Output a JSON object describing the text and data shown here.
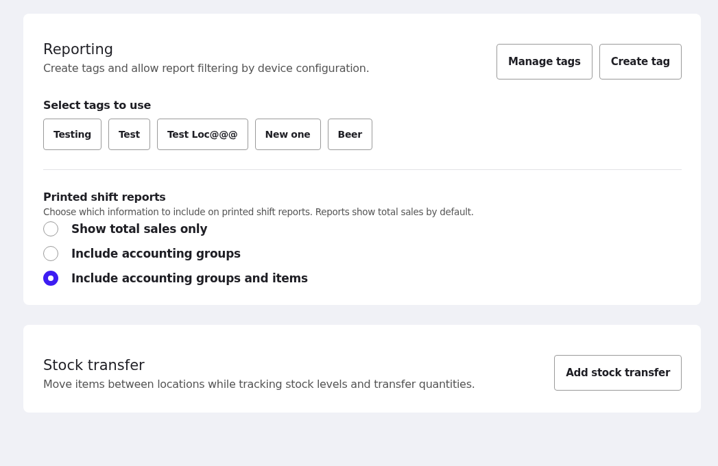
{
  "reporting": {
    "title": "Reporting",
    "description": "Create tags and allow report filtering by device configuration.",
    "buttons": [
      "Manage tags",
      "Create tag"
    ],
    "tags_heading": "Select tags to use",
    "tags": [
      "Testing",
      "Test",
      "Test Loc@@@",
      "New one",
      "Beer"
    ],
    "shift_reports": {
      "title": "Printed shift reports",
      "description": "Choose which information to include on printed shift reports. Reports show total sales by default.",
      "options": [
        {
          "label": "Show total sales only",
          "selected": false
        },
        {
          "label": "Include accounting groups",
          "selected": false
        },
        {
          "label": "Include accounting groups and items",
          "selected": true
        }
      ]
    }
  },
  "stock_transfer": {
    "title": "Stock transfer",
    "description": "Move items between locations while tracking stock levels and transfer quantities.",
    "button": "Add stock transfer"
  }
}
